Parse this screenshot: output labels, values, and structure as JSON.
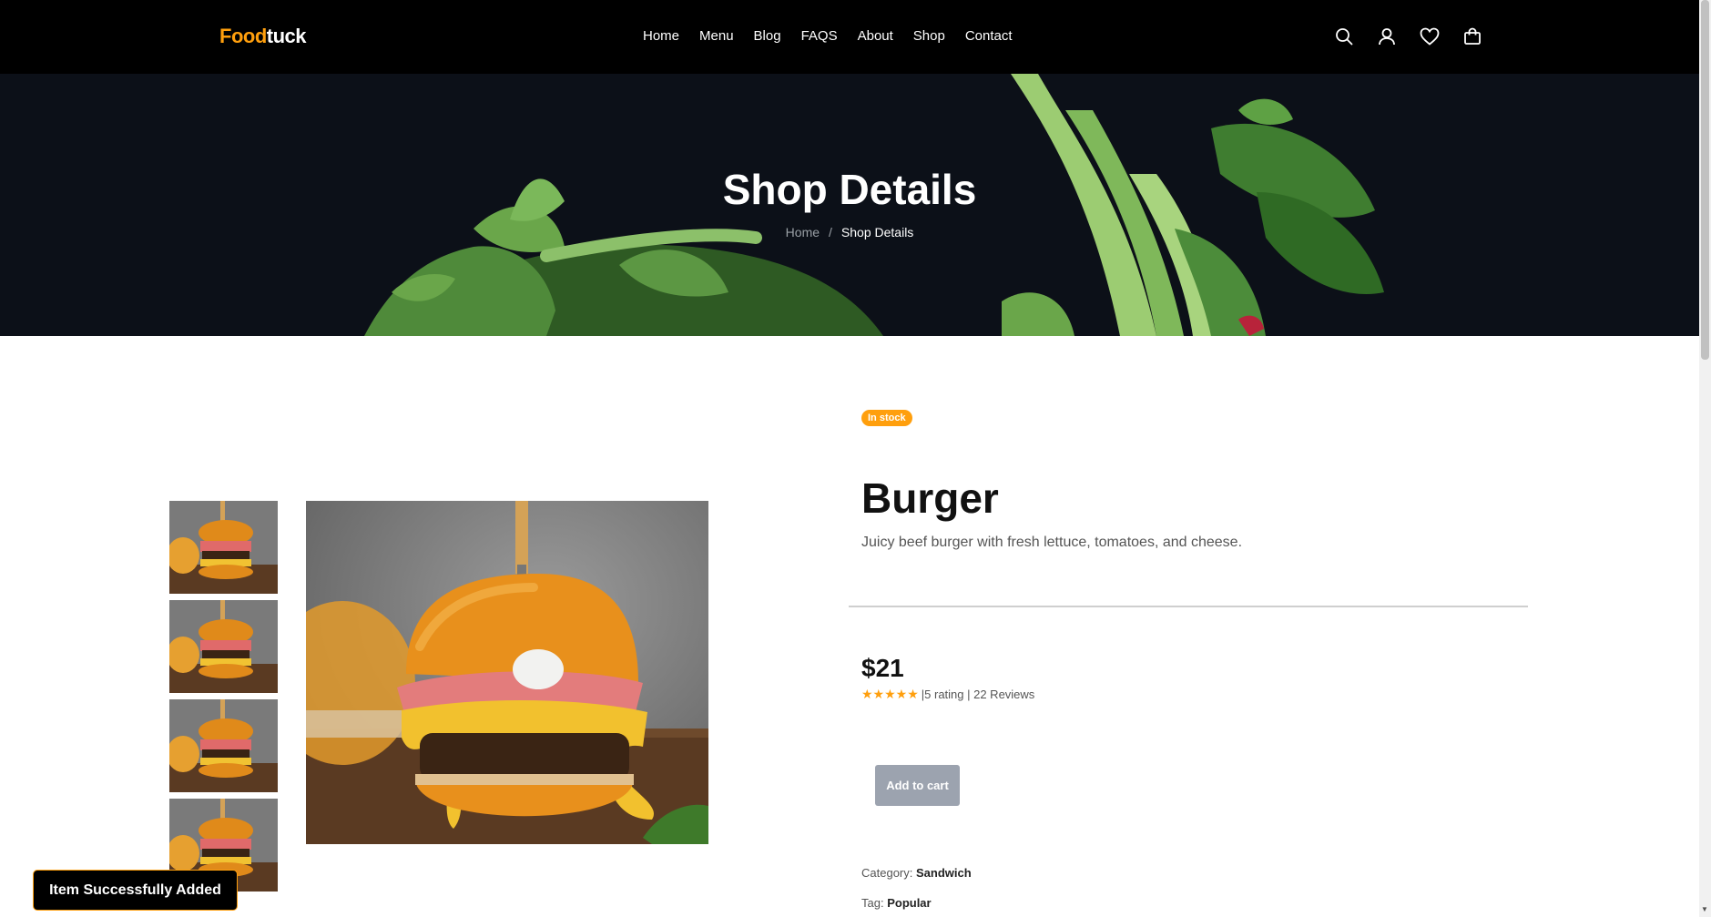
{
  "brand": {
    "part1": "Food",
    "part2": "tuck"
  },
  "nav": {
    "links": [
      "Home",
      "Menu",
      "Blog",
      "FAQS",
      "About",
      "Shop",
      "Contact"
    ]
  },
  "icons": [
    "search-icon",
    "user-icon",
    "heart-icon",
    "bag-icon"
  ],
  "hero": {
    "title": "Shop Details",
    "breadcrumb_home": "Home",
    "breadcrumb_sep": "/",
    "breadcrumb_current": "Shop Details"
  },
  "product": {
    "badge": "In stock",
    "name": "Burger",
    "description": "Juicy beef burger with fresh lettuce, tomatoes, and cheese.",
    "price": "$21",
    "rating_stars": 5,
    "rating_text": "|5 rating | 22 Reviews",
    "add_to_cart": "Add to cart",
    "category_label": "Category:",
    "category_value": "Sandwich",
    "tag_label": "Tag:",
    "tag_value": "Popular"
  },
  "toast": {
    "message": "Item Successfully Added"
  },
  "colors": {
    "accent": "#ff9f0d",
    "nav_bg": "#000000",
    "button_disabled": "#9ca3af"
  }
}
